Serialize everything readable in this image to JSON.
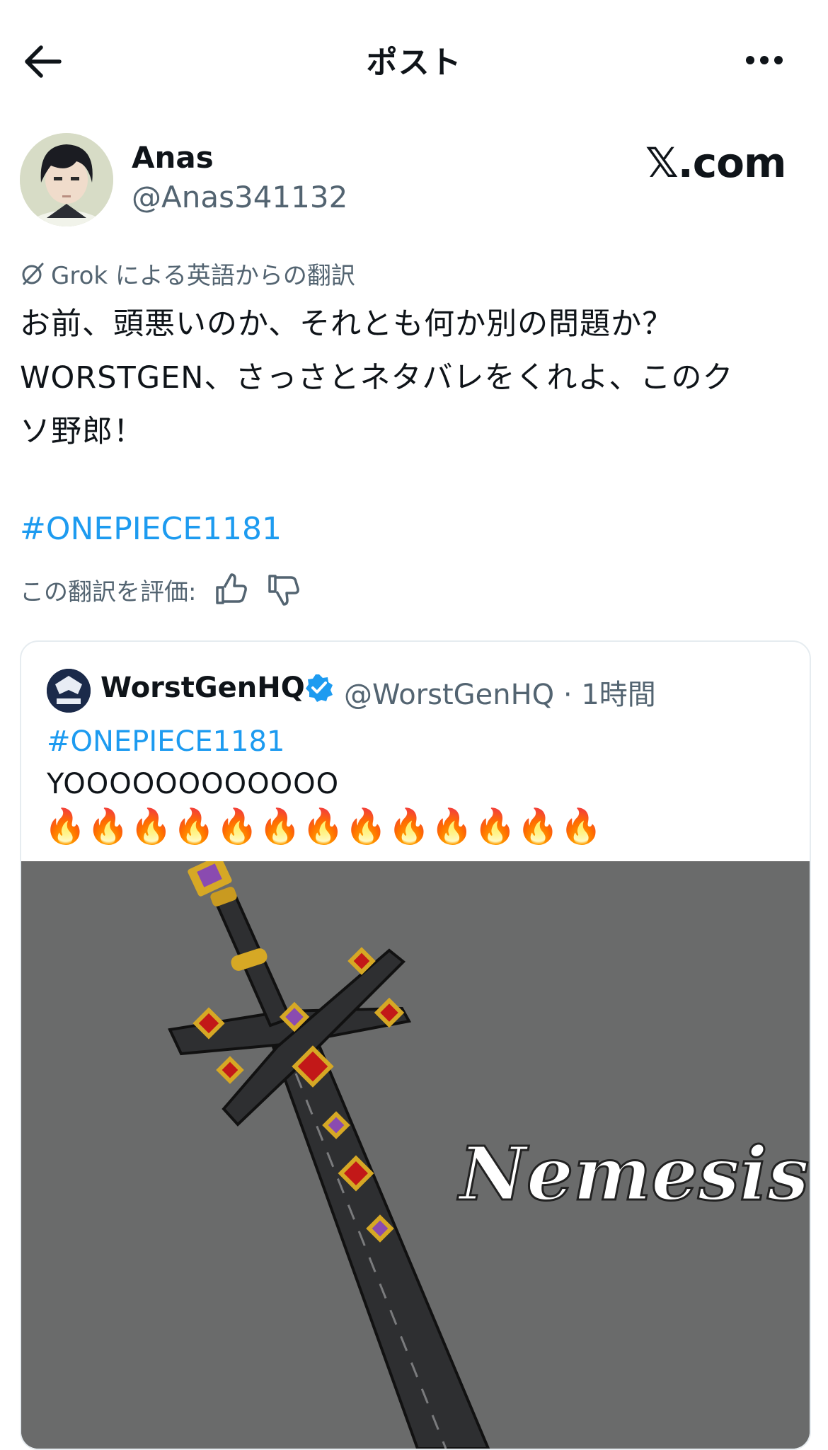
{
  "header": {
    "title": "ポスト",
    "back_icon": "back-arrow-icon",
    "more_icon": "more-dots-icon"
  },
  "author": {
    "display_name": "Anas",
    "handle": "@Anas341132",
    "watermark": "𝕏.com"
  },
  "translation": {
    "label": "Grok による英語からの翻訳",
    "icon": "grok-icon",
    "lines": [
      "お前、頭悪いのか、それとも何か別の問題か？",
      "WORSTGEN、さっさとネタバレをくれよ、このク",
      "ソ野郎！"
    ],
    "hashtag": "#ONEPIECE1181",
    "rate_label": "この翻訳を評価:",
    "thumb_up_icon": "thumbs-up-icon",
    "thumb_down_icon": "thumbs-down-icon"
  },
  "quote": {
    "name": "WorstGenHQ",
    "verified_icon": "verified-badge-icon",
    "handle_time": "@WorstGenHQ · 1時間",
    "hashtag": "#ONEPIECE1181",
    "text": "YOOOOOOOOOOOO",
    "fires": "🔥🔥🔥🔥🔥🔥🔥🔥🔥🔥🔥🔥🔥",
    "media_caption": "Nemesis"
  },
  "colors": {
    "link": "#1d9bf0",
    "secondary_text": "#536471",
    "media_bg": "#6a6b6b"
  }
}
